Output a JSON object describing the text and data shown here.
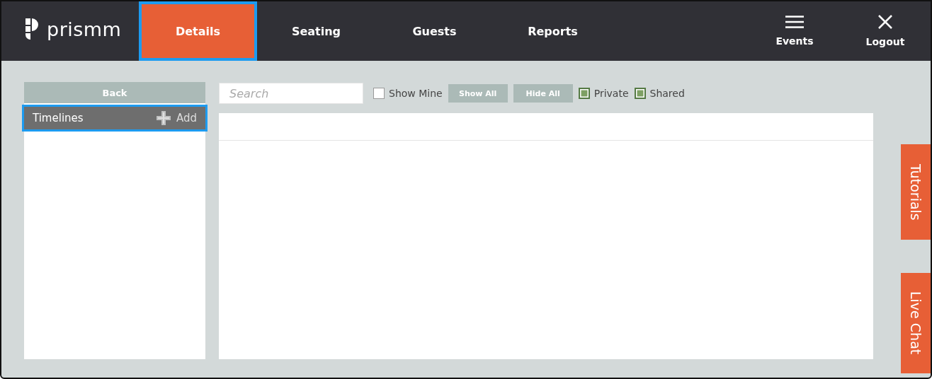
{
  "logo": {
    "text": "prismm"
  },
  "nav_tabs": [
    {
      "label": "Details",
      "selected": true,
      "highlighted": true
    },
    {
      "label": "Seating",
      "selected": false,
      "highlighted": false
    },
    {
      "label": "Guests",
      "selected": false,
      "highlighted": false
    },
    {
      "label": "Reports",
      "selected": false,
      "highlighted": false
    }
  ],
  "header_actions": [
    {
      "kind": "menu",
      "label": "Events"
    },
    {
      "kind": "close",
      "label": "Logout"
    }
  ],
  "sidebar": {
    "back_button": "Back",
    "section": {
      "title": "Timelines",
      "add_label": "Add",
      "highlighted": true
    }
  },
  "toolbar": {
    "search": {
      "placeholder": "Search"
    },
    "show_mine": {
      "label": "Show Mine",
      "checked": false
    },
    "buttons": [
      "Show All",
      "Hide All"
    ],
    "filters": [
      {
        "label": "Private",
        "checked": true
      },
      {
        "label": "Shared",
        "checked": true
      }
    ]
  },
  "side_tabs": [
    "Tutorials",
    "Live Chat"
  ]
}
